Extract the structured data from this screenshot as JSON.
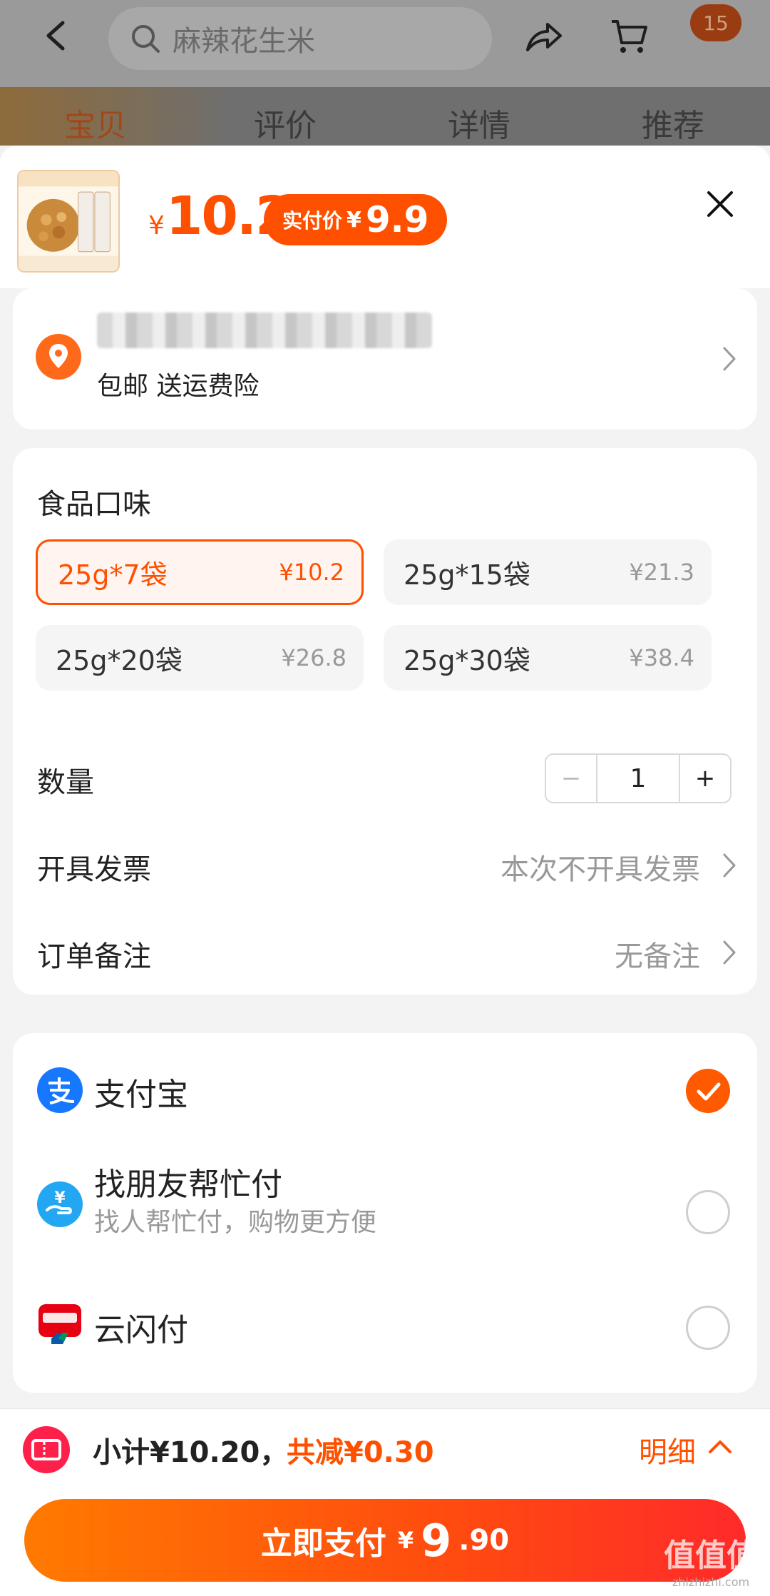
{
  "background": {
    "search_placeholder": "麻辣花生米",
    "cart_badge": "15",
    "tabs": [
      "宝贝",
      "评价",
      "详情",
      "推荐"
    ]
  },
  "sheet": {
    "price_symbol": "¥",
    "price": "10.2",
    "pay_price_label": "实付价",
    "pay_price_symbol": "¥",
    "pay_price": "9.9"
  },
  "address": {
    "shipping_text": "包邮  送运费险"
  },
  "spec": {
    "title": "食品口味",
    "options": [
      {
        "name": "25g*7袋",
        "price": "¥10.2",
        "selected": true
      },
      {
        "name": "25g*15袋",
        "price": "¥21.3",
        "selected": false
      },
      {
        "name": "25g*20袋",
        "price": "¥26.8",
        "selected": false
      },
      {
        "name": "25g*30袋",
        "price": "¥38.4",
        "selected": false
      }
    ],
    "quantity_label": "数量",
    "quantity_minus": "−",
    "quantity_value": "1",
    "quantity_plus": "+",
    "invoice_label": "开具发票",
    "invoice_value": "本次不开具发票",
    "note_label": "订单备注",
    "note_value": "无备注"
  },
  "payment": {
    "methods": [
      {
        "name": "支付宝",
        "subtitle": "",
        "icon": "alipay-icon",
        "selected": true
      },
      {
        "name": "找朋友帮忙付",
        "subtitle": "找人帮忙付，购物更方便",
        "icon": "friend-pay-icon",
        "selected": false
      },
      {
        "name": "云闪付",
        "subtitle": "",
        "icon": "unionpay-icon",
        "selected": false
      }
    ]
  },
  "footer": {
    "subtotal": "小计¥10.20，",
    "discount": "共减¥0.30",
    "detail": "明细",
    "pay_label": "立即支付",
    "pay_symbol": "¥",
    "pay_int": "9",
    "pay_dec": ".90"
  },
  "watermark": {
    "cn": "值值值",
    "en": "zhizhizhi.com"
  },
  "colors": {
    "accent": "#ff5000",
    "alipay": "#1677ff",
    "unionpay": "#e60012"
  }
}
